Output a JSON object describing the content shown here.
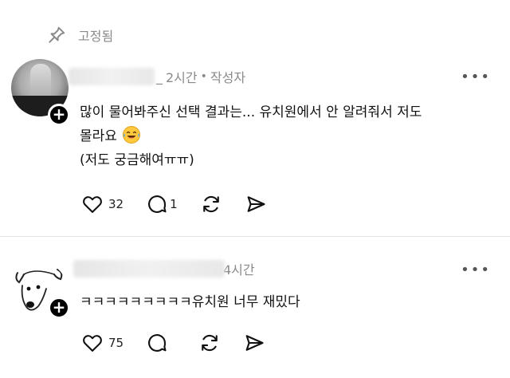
{
  "pinned": {
    "label": "고정됨"
  },
  "posts": [
    {
      "time": "2시간",
      "separator": "_",
      "dot": "•",
      "author_tag": "작성자",
      "more": "•••",
      "lines": [
        "많이 물어봐주신 선택 결과는... 유치원에서 안 알려줘서 저도",
        "몰라요",
        "(저도 궁금해여ㅠㅠ)"
      ],
      "emoji": "laughing-tears-icon",
      "likes": "32",
      "replies": "1"
    },
    {
      "time": "4시간",
      "more": "•••",
      "text": "ㅋㅋㅋㅋㅋㅋㅋㅋㅋ유치원 너무 재밌다",
      "likes": "75"
    }
  ],
  "follow_symbol": "+",
  "colors": {
    "muted": "#8a8a8a",
    "text": "#111111",
    "divider": "#e4e4e4",
    "badge": "#000000"
  }
}
